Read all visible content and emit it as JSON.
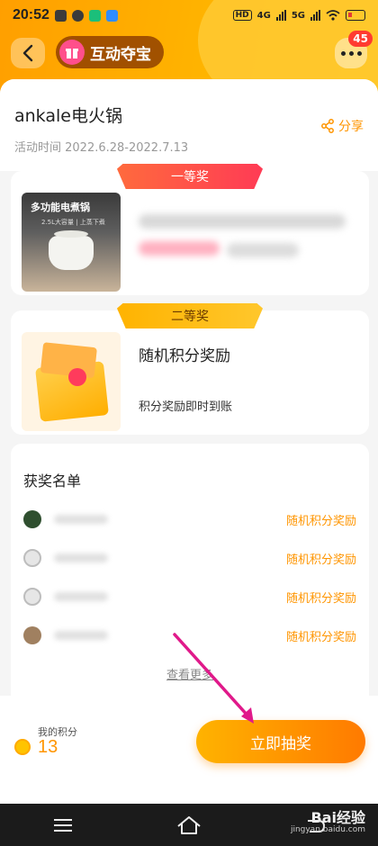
{
  "status_bar": {
    "time": "20:52",
    "network": "4G",
    "network2": "5G"
  },
  "header": {
    "title": "互动夺宝",
    "badge_count": "45"
  },
  "activity": {
    "title": "ankale电火锅",
    "date": "活动时间 2022.6.28-2022.7.13",
    "share_label": "分享"
  },
  "prizes": [
    {
      "tier": "一等奖",
      "image_title": "多功能电煮锅",
      "image_sub": "2.5L大容量 | 上蒸下煮"
    },
    {
      "tier": "二等奖",
      "name": "随机积分奖励",
      "desc": "积分奖励即时到账"
    }
  ],
  "winners": {
    "title": "获奖名单",
    "rows": [
      {
        "prize": "随机积分奖励"
      },
      {
        "prize": "随机积分奖励"
      },
      {
        "prize": "随机积分奖励"
      },
      {
        "prize": "随机积分奖励"
      }
    ],
    "see_more": "查看更多"
  },
  "footer": {
    "points_label": "我的积分",
    "points_value": "13",
    "lottery_button": "立即抽奖"
  },
  "watermark": {
    "main": "Bai经验",
    "sub": "jingyan.baidu.com"
  },
  "colors": {
    "accent": "#ff9500",
    "header": "#ffb400",
    "ribbon_first": "#ff4a4a",
    "ribbon_second": "#ffb300"
  }
}
